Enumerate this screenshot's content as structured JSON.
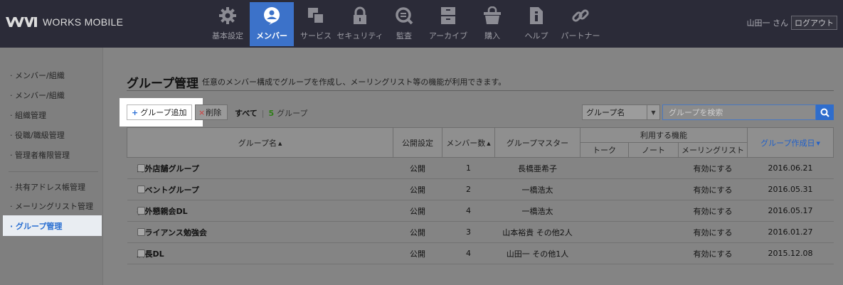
{
  "header": {
    "logo_text": "WORKS MOBILE",
    "nav": [
      {
        "label": "基本設定",
        "icon": "gear-icon"
      },
      {
        "label": "メンバー",
        "icon": "member-icon",
        "active": true
      },
      {
        "label": "サービス",
        "icon": "service-icon"
      },
      {
        "label": "セキュリティ",
        "icon": "lock-icon"
      },
      {
        "label": "監査",
        "icon": "audit-icon"
      },
      {
        "label": "アーカイブ",
        "icon": "archive-icon"
      },
      {
        "label": "購入",
        "icon": "basket-icon"
      },
      {
        "label": "ヘルプ",
        "icon": "help-icon"
      },
      {
        "label": "パートナー",
        "icon": "link-icon"
      }
    ],
    "user_name": "山田一 さん",
    "logout_label": "ログアウト",
    "active_color": "#3c72c9"
  },
  "sidebar": {
    "items": [
      {
        "label": "· メンバー/組織"
      },
      {
        "label": "· メンバー/組織"
      },
      {
        "label": "· 組織管理"
      },
      {
        "label": "· 役職/職級管理"
      },
      {
        "label": "· 管理者権限管理"
      },
      {
        "label": "· 共有アドレス帳管理"
      },
      {
        "label": "· メーリングリスト管理"
      },
      {
        "label": "· グループ管理",
        "active": true
      }
    ]
  },
  "main": {
    "title": "グループ管理",
    "description": "任意のメンバー構成でグループを作成し、メーリングリスト等の機能が利用できます。",
    "add_button": "グループ追加",
    "delete_button": "削除",
    "filter_all": "すべて",
    "filter_separator": "|",
    "group_count": "5",
    "group_unit": "グループ",
    "search_select": "グループ名",
    "search_placeholder": "グループを検索"
  },
  "table": {
    "headers": {
      "name": "グループ名",
      "visibility": "公開設定",
      "members": "メンバー数",
      "master": "グループマスター",
      "features": "利用する機能",
      "talk": "トーク",
      "note": "ノート",
      "mailing": "メーリングリスト",
      "created": "グループ作成日"
    },
    "rows": [
      {
        "name": "海外店舗グループ",
        "visibility": "公開",
        "members": "1",
        "master": "長橋亜希子",
        "mailing": "有効にする",
        "created": "2016.06.21"
      },
      {
        "name": "イベントグループ",
        "visibility": "公開",
        "members": "2",
        "master": "一橋浩太",
        "mailing": "有効にする",
        "created": "2016.05.31"
      },
      {
        "name": "社外懇親会DL",
        "visibility": "公開",
        "members": "4",
        "master": "一橋浩太",
        "mailing": "有効にする",
        "created": "2016.05.17"
      },
      {
        "name": "アライアンス勉強会",
        "visibility": "公開",
        "members": "3",
        "master": "山本裕貴 その他2人",
        "mailing": "有効にする",
        "created": "2016.01.27"
      },
      {
        "name": "店長DL",
        "visibility": "公開",
        "members": "4",
        "master": "山田一 その他1人",
        "mailing": "有効にする",
        "created": "2015.12.08"
      }
    ]
  }
}
